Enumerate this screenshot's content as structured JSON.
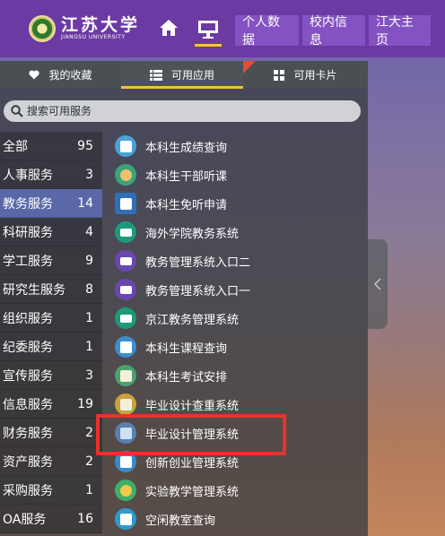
{
  "brand": {
    "name_cn": "江苏大学",
    "name_en": "JIANGSU UNIVERSITY"
  },
  "topnav": {
    "icons": [
      "home-icon",
      "desktop-icon"
    ],
    "links": [
      "个人数据",
      "校内信息",
      "江大主页"
    ],
    "accent": "#f5c23c",
    "bar_color": "#6b3aa3"
  },
  "tabs": [
    {
      "label": "我的收藏",
      "icon": "heart-icon"
    },
    {
      "label": "可用应用",
      "icon": "list-icon"
    },
    {
      "label": "可用卡片",
      "icon": "grid-icon"
    }
  ],
  "search": {
    "placeholder": "搜索可用服务"
  },
  "categories": [
    {
      "label": "全部",
      "count": "95"
    },
    {
      "label": "人事服务",
      "count": "3"
    },
    {
      "label": "教务服务",
      "count": "14"
    },
    {
      "label": "科研服务",
      "count": "4"
    },
    {
      "label": "学工服务",
      "count": "9"
    },
    {
      "label": "研究生服务",
      "count": "8"
    },
    {
      "label": "组织服务",
      "count": "1"
    },
    {
      "label": "纪委服务",
      "count": "1"
    },
    {
      "label": "宣传服务",
      "count": "3"
    },
    {
      "label": "信息服务",
      "count": "19"
    },
    {
      "label": "财务服务",
      "count": "2"
    },
    {
      "label": "资产服务",
      "count": "2"
    },
    {
      "label": "采购服务",
      "count": "1"
    },
    {
      "label": "OA服务",
      "count": "16"
    }
  ],
  "active_category": "教务服务",
  "apps": [
    {
      "label": "本科生成绩查询",
      "icon": "grade-report-icon",
      "color": "#4aa3d8"
    },
    {
      "label": "本科生干部听课",
      "icon": "teacher-icon",
      "color": "#3aa37a"
    },
    {
      "label": "本科生免听申请",
      "icon": "calendar-icon",
      "color": "#2f6fb8"
    },
    {
      "label": "海外学院教务系统",
      "icon": "screen-icon",
      "color": "#1d9a7c"
    },
    {
      "label": "教务管理系统入口二",
      "icon": "screen-icon",
      "color": "#6b46b0"
    },
    {
      "label": "教务管理系统入口一",
      "icon": "screen-icon",
      "color": "#6b46b0"
    },
    {
      "label": "京江教务管理系统",
      "icon": "screen-icon",
      "color": "#1d9a7c"
    },
    {
      "label": "本科生课程查询",
      "icon": "course-search-icon",
      "color": "#3c8fcc"
    },
    {
      "label": "本科生考试安排",
      "icon": "exam-list-icon",
      "color": "#4aa070"
    },
    {
      "label": "毕业设计查重系统",
      "icon": "check-doc-icon",
      "color": "#c8a23c"
    },
    {
      "label": "毕业设计管理系统",
      "icon": "building-icon",
      "color": "#5a7fb0"
    },
    {
      "label": "创新创业管理系统",
      "icon": "rocket-icon",
      "color": "#3a8acb"
    },
    {
      "label": "实验教学管理系统",
      "icon": "lab-icon",
      "color": "#3fae6a"
    },
    {
      "label": "空闲教室查询",
      "icon": "classroom-icon",
      "color": "#2f9ad0"
    }
  ]
}
